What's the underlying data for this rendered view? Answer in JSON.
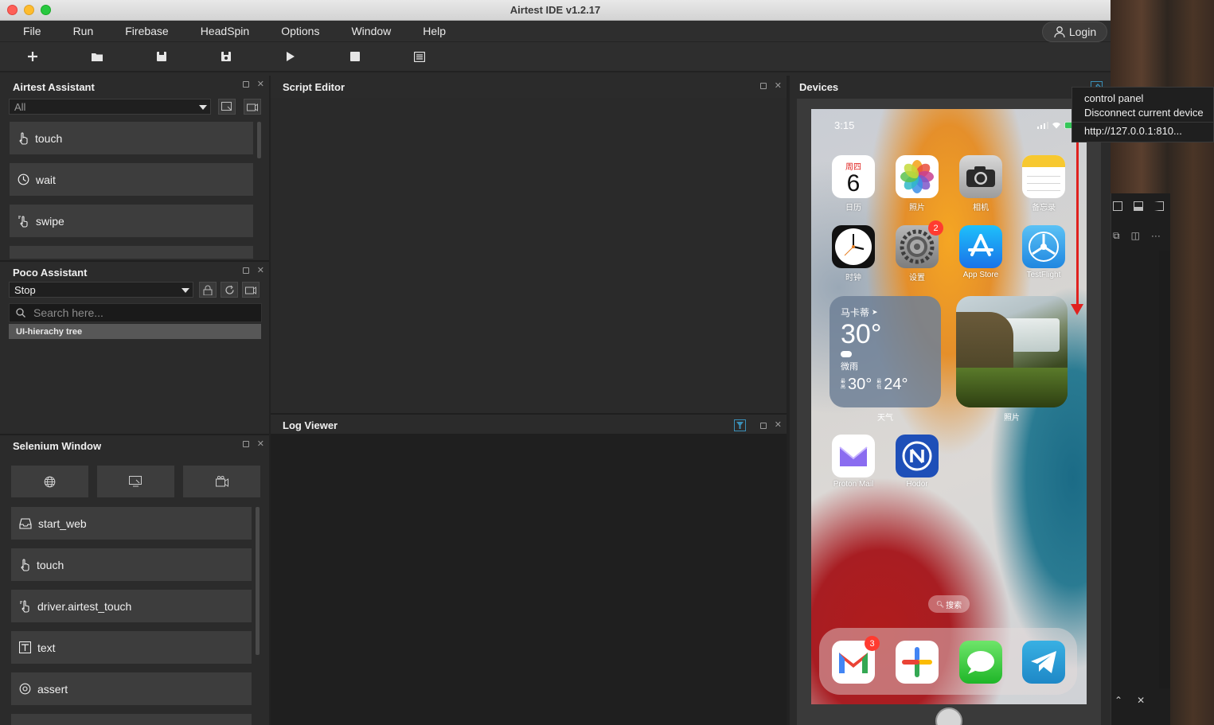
{
  "window": {
    "title": "Airtest IDE v1.2.17"
  },
  "menu": [
    "File",
    "Run",
    "Firebase",
    "HeadSpin",
    "Options",
    "Window",
    "Help"
  ],
  "login": {
    "label": "Login"
  },
  "panels": {
    "airtest": {
      "title": "Airtest Assistant",
      "filter_value": "All",
      "commands": [
        "touch",
        "wait",
        "swipe"
      ]
    },
    "poco": {
      "title": "Poco Assistant",
      "mode_value": "Stop",
      "search_placeholder": "Search here...",
      "tree_item": "UI-hierachy tree"
    },
    "selenium": {
      "title": "Selenium Window",
      "commands": [
        "start_web",
        "touch",
        "driver.airtest_touch",
        "text",
        "assert"
      ]
    },
    "editor": {
      "title": "Script Editor"
    },
    "log": {
      "title": "Log Viewer"
    },
    "devices": {
      "title": "Devices"
    }
  },
  "context_menu": [
    "control panel",
    "Disconnect current device",
    "http://127.0.0.1:810..."
  ],
  "phone": {
    "time": "3:15",
    "apps_row1": [
      {
        "label": "日历",
        "weekday": "周四",
        "day": "6"
      },
      {
        "label": "照片"
      },
      {
        "label": "相机"
      },
      {
        "label": "备忘录"
      }
    ],
    "apps_row2": [
      {
        "label": "时钟"
      },
      {
        "label": "设置",
        "badge": "2"
      },
      {
        "label": "App Store"
      },
      {
        "label": "TestFlight"
      }
    ],
    "weather": {
      "city": "马卡蒂",
      "temp": "30°",
      "condition": "微雨",
      "high": "30°",
      "low": "24°",
      "high_prefix": "最高",
      "low_prefix": "最低",
      "label": "天气"
    },
    "photo_widget_label": "照片",
    "apps_row3": [
      {
        "label": "Proton Mail"
      },
      {
        "label": "Hodor"
      }
    ],
    "search_pill": "搜索",
    "dock_badge": "3"
  },
  "colors": {
    "accent_red": "#e0211e",
    "panel": "#2b2b2b",
    "button": "#3d3d3d"
  }
}
